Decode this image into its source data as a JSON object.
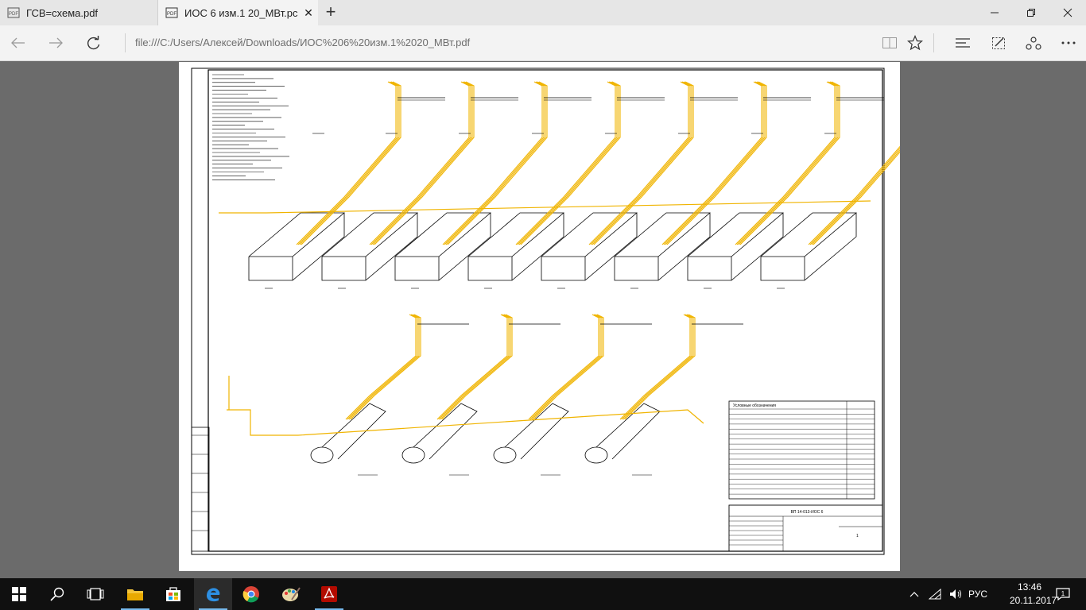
{
  "tabs": [
    {
      "title": "ГСВ=схема.pdf",
      "favicon": "pdf-icon"
    },
    {
      "title": "ИОС 6 изм.1 20_МВт.pc",
      "favicon": "pdf-icon"
    }
  ],
  "address": "file:///C:/Users/Алексей/Downloads/ИОС%206%20изм.1%2020_МВт.pdf",
  "toolbar_icons": [
    "back-icon",
    "forward-icon",
    "refresh-icon",
    "reading-view-icon",
    "favorite-star-icon",
    "hub-icon",
    "web-note-icon",
    "share-icon",
    "more-icon"
  ],
  "window_controls": [
    "minimize-icon",
    "restore-icon",
    "close-icon"
  ],
  "document": {
    "title_block_code": "ВП 14-013-ИОС 6",
    "sheet": "1",
    "legend_title": "Условные обозначения"
  },
  "taskbar": {
    "apps": [
      "start-icon",
      "search-icon",
      "task-view-icon",
      "file-explorer-icon",
      "store-icon",
      "edge-icon",
      "chrome-icon",
      "paint-icon",
      "acrobat-icon"
    ],
    "language": "РУС",
    "time": "13:46",
    "date": "20.11.2017"
  },
  "colors": {
    "pipe": "#f0b400",
    "drawing": "#000000",
    "tabbar": "#e6e6e6",
    "viewer_bg": "#6b6b6b"
  }
}
